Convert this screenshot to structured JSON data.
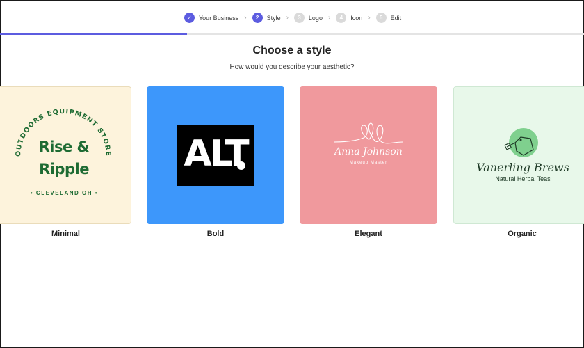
{
  "stepper": {
    "steps": [
      {
        "num": "✓",
        "label": "Your Business",
        "state": "done"
      },
      {
        "num": "2",
        "label": "Style",
        "state": "active"
      },
      {
        "num": "3",
        "label": "Logo",
        "state": "todo"
      },
      {
        "num": "4",
        "label": "Icon",
        "state": "todo"
      },
      {
        "num": "5",
        "label": "Edit",
        "state": "todo"
      }
    ],
    "separator": "›",
    "accent_color": "#5c5ce0",
    "progress": 0.32
  },
  "heading": {
    "title": "Choose a style",
    "subtitle": "How would you describe your aesthetic?"
  },
  "styles": [
    {
      "label": "Minimal",
      "bg_color": "#fdf3dc",
      "logo": {
        "arc_text": "OUTDOORS EQUIPMENT STORE",
        "line1": "Rise &",
        "line2": "Ripple",
        "city": "• CLEVELAND OH •",
        "color": "#1e6b33"
      }
    },
    {
      "label": "Bold",
      "bg_color": "#3d97fb",
      "logo": {
        "text": "ALT"
      }
    },
    {
      "label": "Elegant",
      "bg_color": "#f0999d",
      "logo": {
        "name": "Anna Johnson",
        "tagline": "Makeup Master"
      }
    },
    {
      "label": "Organic",
      "bg_color": "#e8f8ea",
      "logo": {
        "name": "Vanerling Brews",
        "tagline": "Natural Herbal Teas"
      }
    }
  ]
}
